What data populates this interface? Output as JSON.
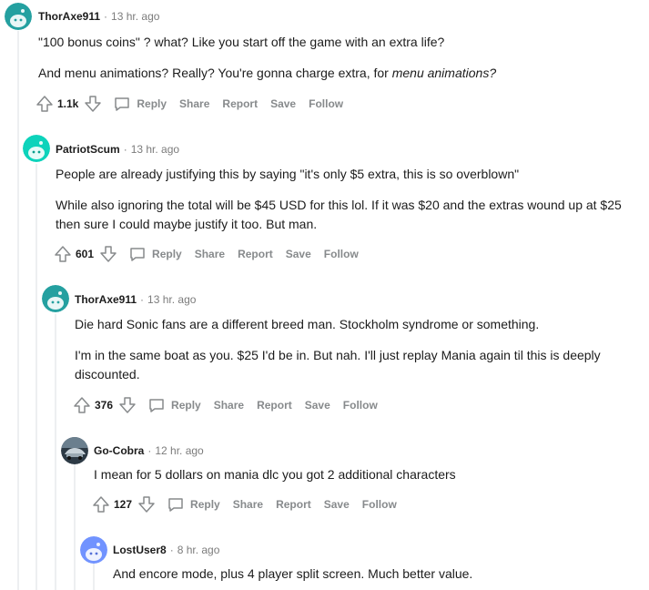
{
  "comments": [
    {
      "author": "ThorAxe911",
      "time": "13 hr. ago",
      "paragraphs": [
        "\"100 bonus coins\" ? what? Like you start off the game with an extra life?",
        "And menu animations? Really? You're gonna charge extra, for "
      ],
      "emphasis": "menu animations?",
      "score": "1.1k",
      "avatar_color": "#24a0a0"
    },
    {
      "author": "PatriotScum",
      "time": "13 hr. ago",
      "paragraphs": [
        "People are already justifying this by saying \"it's only $5 extra, this is so overblown\"",
        "While also ignoring the total will be $45 USD for this lol. If it was $20 and the extras wound up at $25 then sure I could maybe justify it too. But man."
      ],
      "score": "601",
      "avatar_color": "#0dd3bb"
    },
    {
      "author": "ThorAxe911",
      "time": "13 hr. ago",
      "paragraphs": [
        "Die hard Sonic fans are a different breed man. Stockholm syndrome or something.",
        "I'm in the same boat as you. $25 I'd be in. But nah. I'll just replay Mania again til this is deeply discounted."
      ],
      "score": "376",
      "avatar_color": "#24a0a0"
    },
    {
      "author": "Go-Cobra",
      "time": "12 hr. ago",
      "paragraphs": [
        "I mean for 5 dollars on mania dlc you got 2 additional characters"
      ],
      "score": "127",
      "avatar_color": "#2d3a45"
    },
    {
      "author": "LostUser8",
      "time": "8 hr. ago",
      "paragraphs": [
        "And encore mode, plus 4 player split screen. Much better value."
      ],
      "avatar_color": "#7193ff"
    }
  ],
  "actions": {
    "reply": "Reply",
    "share": "Share",
    "report": "Report",
    "save": "Save",
    "follow": "Follow"
  },
  "colors": {
    "meta": "#7c7c7c",
    "action": "#878a8c",
    "thread_line": "#edeff1"
  },
  "icons": [
    "upvote-icon",
    "downvote-icon",
    "comment-icon",
    "snoo-avatar-icon"
  ]
}
